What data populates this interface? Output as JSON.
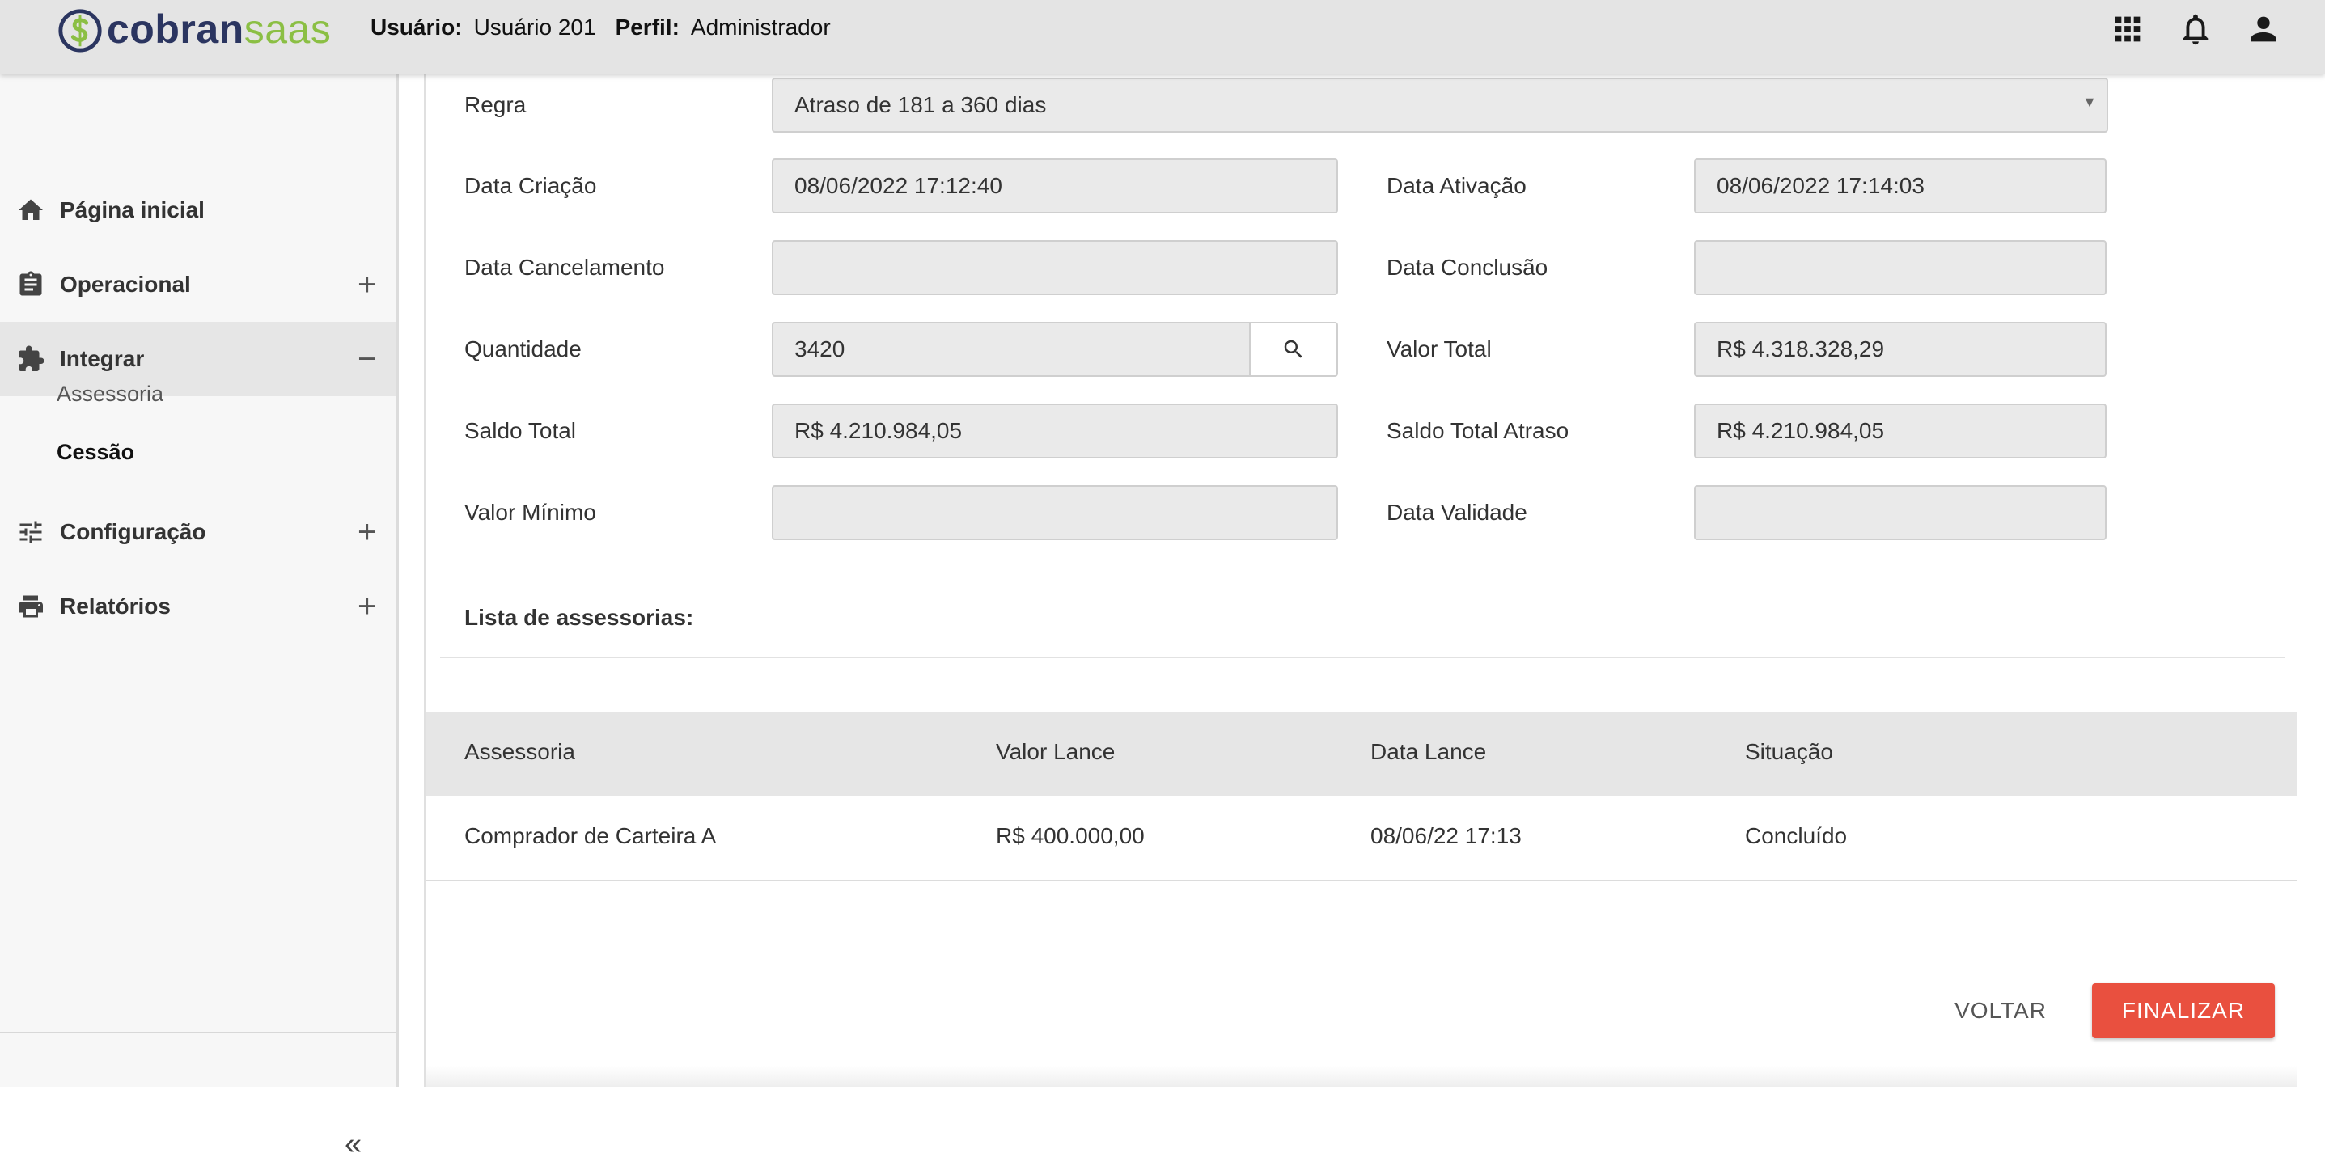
{
  "header": {
    "logo_part1": "cobran",
    "logo_part2": "saas",
    "user_label": "Usuário:",
    "user_value": "Usuário 201",
    "profile_label": "Perfil:",
    "profile_value": "Administrador",
    "icons": [
      "apps-grid-icon",
      "bell-icon",
      "user-icon"
    ]
  },
  "sidebar": {
    "items": [
      {
        "label": "Página inicial",
        "icon": "home-icon",
        "toggle": ""
      },
      {
        "label": "Operacional",
        "icon": "clipboard-icon",
        "toggle": "+"
      },
      {
        "label": "Integrar",
        "icon": "puzzle-icon",
        "toggle": "−"
      },
      {
        "label": "Configuração",
        "icon": "sliders-icon",
        "toggle": "+"
      },
      {
        "label": "Relatórios",
        "icon": "printer-icon",
        "toggle": "+"
      }
    ],
    "subitems": [
      {
        "label": "Assessoria"
      },
      {
        "label": "Cessão"
      }
    ],
    "collapse": "«"
  },
  "form": {
    "regra": {
      "label": "Regra",
      "value": "Atraso de 181 a 360 dias"
    },
    "data_criacao": {
      "label": "Data Criação",
      "value": "08/06/2022 17:12:40"
    },
    "data_ativacao": {
      "label": "Data Ativação",
      "value": "08/06/2022 17:14:03"
    },
    "data_cancelamento": {
      "label": "Data Cancelamento",
      "value": ""
    },
    "data_conclusao": {
      "label": "Data Conclusão",
      "value": ""
    },
    "quantidade": {
      "label": "Quantidade",
      "value": "3420"
    },
    "valor_total": {
      "label": "Valor Total",
      "value": "R$ 4.318.328,29"
    },
    "saldo_total": {
      "label": "Saldo Total",
      "value": "R$ 4.210.984,05"
    },
    "saldo_total_atraso": {
      "label": "Saldo Total Atraso",
      "value": "R$ 4.210.984,05"
    },
    "valor_minimo": {
      "label": "Valor Mínimo",
      "value": ""
    },
    "data_validade": {
      "label": "Data Validade",
      "value": ""
    }
  },
  "list": {
    "title": "Lista de assessorias:",
    "columns": [
      "Assessoria",
      "Valor Lance",
      "Data Lance",
      "Situação"
    ],
    "rows": [
      [
        "Comprador de Carteira A",
        "R$ 400.000,00",
        "08/06/22 17:13",
        "Concluído"
      ]
    ]
  },
  "actions": {
    "back": "VOLTAR",
    "finish": "FINALIZAR"
  },
  "colors": {
    "brand_dark": "#2b3560",
    "brand_green": "#8bbf44",
    "primary_action": "#e9503f"
  }
}
